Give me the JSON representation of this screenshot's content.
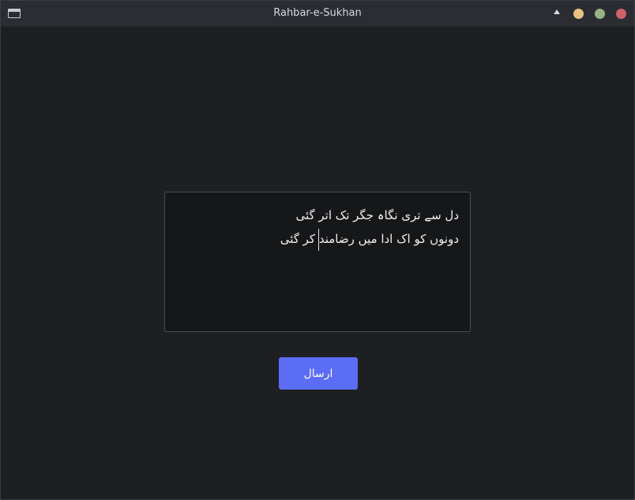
{
  "window": {
    "title": "Rahbar-e-Sukhan"
  },
  "editor": {
    "line1": "دل سے تری نگاہ جگر تک اتر گئی",
    "line2": "دونوں کو اک ادا میں رضامند کر گئی"
  },
  "send_button": {
    "label": "ارسال"
  },
  "colors": {
    "accent": "#5b6cf5",
    "background": "#1e1f22",
    "titlebar": "#2b2d33",
    "minimize": "#e8c27f",
    "maximize": "#96b384",
    "close": "#d0606a"
  },
  "icons": [
    "app-window-icon",
    "shade-up-icon",
    "minimize-icon",
    "maximize-icon",
    "close-icon"
  ]
}
